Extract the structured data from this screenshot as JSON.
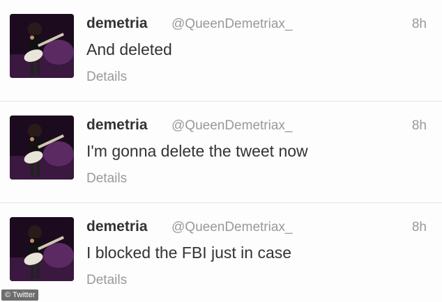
{
  "colors": {
    "name": "#333333",
    "meta": "#999999",
    "divider": "#e3e3e3"
  },
  "tweets": [
    {
      "name": "demetria",
      "handle": "@QueenDemetriax_",
      "time": "8h",
      "text": "And deleted",
      "details": "Details",
      "avatar_icon": "profile-photo"
    },
    {
      "name": "demetria",
      "handle": "@QueenDemetriax_",
      "time": "8h",
      "text": "I'm gonna delete the tweet now",
      "details": "Details",
      "avatar_icon": "profile-photo"
    },
    {
      "name": "demetria",
      "handle": "@QueenDemetriax_",
      "time": "8h",
      "text": "I blocked the FBI just in case",
      "details": "Details",
      "avatar_icon": "profile-photo"
    }
  ],
  "watermark": "© Twitter"
}
